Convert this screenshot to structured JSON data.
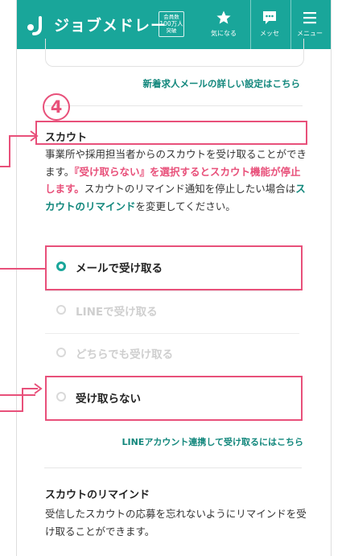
{
  "header": {
    "logo_text": "ジョブメドレー",
    "member_badge": [
      "会員数",
      "100万人",
      "突破"
    ],
    "nav": [
      {
        "label": "気になる",
        "icon": "star-icon"
      },
      {
        "label": "メッセ",
        "icon": "chat-icon"
      },
      {
        "label": "メニュー",
        "icon": "menu-icon"
      }
    ]
  },
  "link_new_jobs_mail": "新着求人メールの詳しい設定はこちら",
  "step_number": "4",
  "scout": {
    "title": "スカウト",
    "desc_1": "事業所や採用担当者からのスカウトを受け取ることができます。",
    "desc_pink": "『受け取らない』を選択するとスカウト機能が停止します。",
    "desc_2": "スカウトのリマインド通知を停止したい場合は",
    "desc_teal": "スカウトのリマインド",
    "desc_3": "を変更してください。",
    "options": [
      {
        "label": "メールで受け取る",
        "selected": true,
        "enabled": true
      },
      {
        "label": "LINEで受け取る",
        "selected": false,
        "enabled": false
      },
      {
        "label": "どちらでも受け取る",
        "selected": false,
        "enabled": false
      },
      {
        "label": "受け取らない",
        "selected": false,
        "enabled": true
      }
    ],
    "line_link": "LINEアカウント連携して受け取るにはこちら"
  },
  "reminder": {
    "title": "スカウトのリマインド",
    "desc": "受信したスカウトの応募を忘れないようにリマインドを受け取ることができます。"
  },
  "colors": {
    "brand": "#19a69a",
    "link": "#12877c",
    "annotation": "#e8507a"
  }
}
